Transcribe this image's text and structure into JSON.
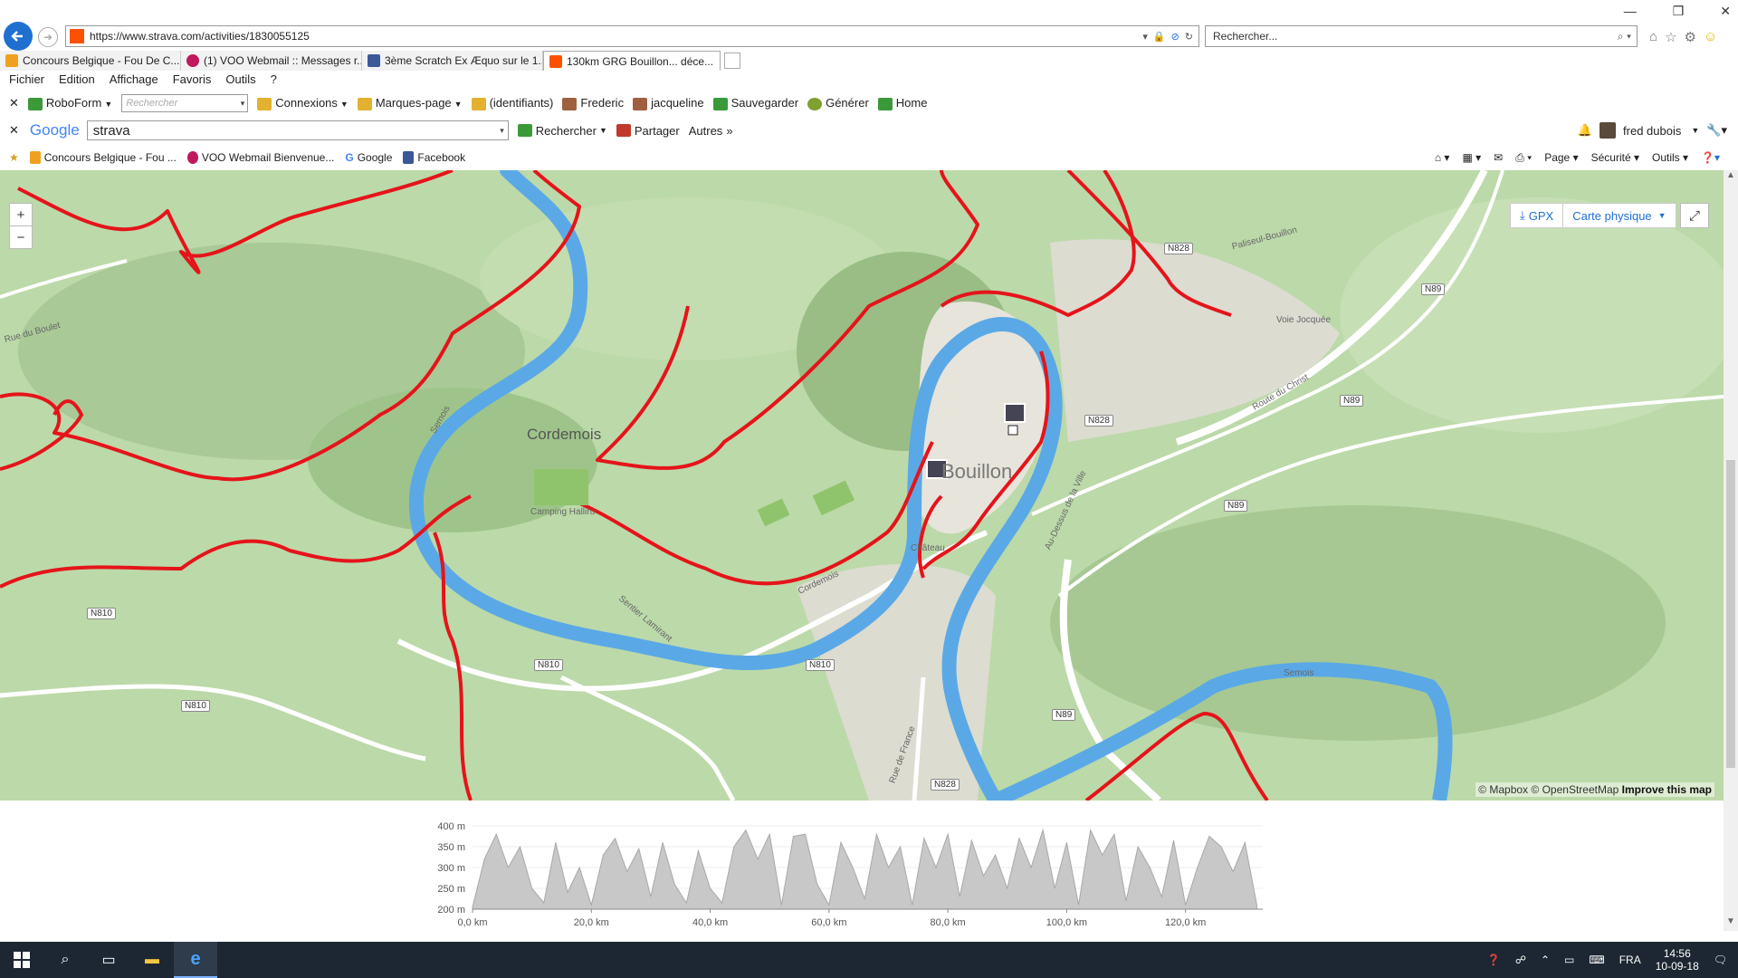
{
  "browser": {
    "url": "https://www.strava.com/activities/1830055125",
    "search_placeholder": "Rechercher...",
    "tabs": [
      {
        "label": "Concours Belgique - Fou De C...",
        "color": "#f0a020"
      },
      {
        "label": "(1) VOO Webmail :: Messages r...",
        "color": "#c0185c"
      },
      {
        "label": "3ème Scratch Ex Æquo sur le 1...",
        "color": "#3b5998"
      },
      {
        "label": "130km GRG Bouillon... déce...",
        "color": "#fc5200"
      }
    ],
    "menu": [
      "Fichier",
      "Edition",
      "Affichage",
      "Favoris",
      "Outils",
      "?"
    ],
    "roboform": {
      "label": "RoboForm",
      "search_placeholder": "Rechercher",
      "items": [
        "Connexions",
        "Marques-page",
        "(identifiants)",
        "Frederic",
        "jacqueline",
        "Sauvegarder",
        "Générer",
        "Home"
      ]
    },
    "google_bar": {
      "logo": "Google",
      "query": "strava",
      "search_btn": "Rechercher",
      "share_btn": "Partager",
      "more_btn": "Autres",
      "user": "fred dubois"
    },
    "favorites": [
      "Concours Belgique - Fou ...",
      "VOO Webmail  Bienvenue...",
      "Google",
      "Facebook"
    ],
    "command_bar": [
      "Page",
      "Sécurité",
      "Outils"
    ]
  },
  "map": {
    "controls": {
      "zoom_in": "+",
      "zoom_out": "−",
      "gpx": "GPX",
      "map_type": "Carte physique"
    },
    "attribution": {
      "mapbox": "© Mapbox",
      "osm": "© OpenStreetMap",
      "improve": "Improve this map"
    },
    "places": {
      "cordemois": "Cordemois",
      "bouillon": "Bouillon"
    },
    "road_labels": [
      "N828",
      "N89",
      "N828",
      "N89",
      "N89",
      "N810",
      "N810",
      "N810",
      "N810",
      "N89",
      "N828"
    ],
    "street_labels": [
      "Rue du Boulet",
      "Voie Jocquée",
      "Route du Christ",
      "Paliseul-Bouillon",
      "Semois",
      "Sentier Lamirant",
      "Camping Halliru",
      "Au-Dessus de la Ville",
      "Château",
      "Cordemois",
      "Rue de France",
      "Semois"
    ],
    "route_color": "#e5141a",
    "river_color": "#5aa9e6"
  },
  "elevation": {
    "y_labels": [
      "400 m",
      "350 m",
      "300 m",
      "250 m",
      "200 m"
    ],
    "x_labels": [
      "0,0 km",
      "20,0 km",
      "40,0 km",
      "60,0 km",
      "80,0 km",
      "100,0 km",
      "120,0 km"
    ]
  },
  "chart_data": {
    "type": "area",
    "xlabel": "",
    "ylabel": "",
    "ylim": [
      200,
      400
    ],
    "xlim": [
      0,
      133
    ],
    "x": [
      0,
      2,
      4,
      6,
      8,
      10,
      12,
      14,
      16,
      18,
      20,
      22,
      24,
      26,
      28,
      30,
      32,
      34,
      36,
      38,
      40,
      42,
      44,
      46,
      48,
      50,
      52,
      54,
      56,
      58,
      60,
      62,
      64,
      66,
      68,
      70,
      72,
      74,
      76,
      78,
      80,
      82,
      84,
      86,
      88,
      90,
      92,
      94,
      96,
      98,
      100,
      102,
      104,
      106,
      108,
      110,
      112,
      114,
      116,
      118,
      120,
      122,
      124,
      126,
      128,
      130,
      132
    ],
    "series": [
      {
        "values": [
          205,
          320,
          380,
          300,
          350,
          250,
          215,
          360,
          240,
          300,
          210,
          330,
          370,
          290,
          345,
          230,
          360,
          260,
          215,
          340,
          250,
          215,
          350,
          390,
          320,
          380,
          210,
          375,
          380,
          260,
          210,
          360,
          300,
          225,
          380,
          300,
          350,
          210,
          370,
          300,
          380,
          230,
          365,
          280,
          330,
          250,
          370,
          300,
          390,
          250,
          360,
          210,
          390,
          330,
          380,
          220,
          350,
          300,
          230,
          365,
          210,
          300,
          375,
          350,
          290,
          360,
          210
        ]
      }
    ]
  },
  "taskbar": {
    "time": "14:56",
    "date": "10-09-18",
    "lang": "FRA"
  }
}
